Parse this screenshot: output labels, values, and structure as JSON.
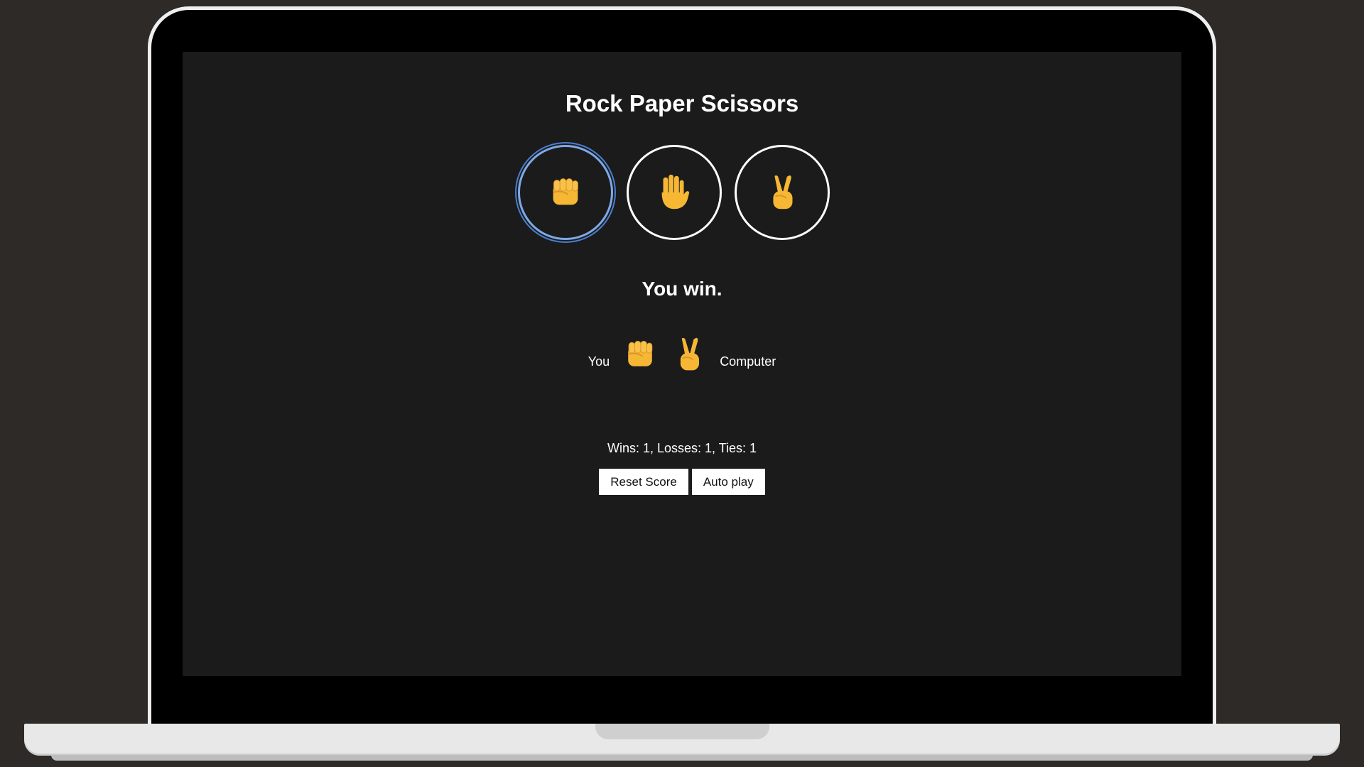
{
  "game": {
    "title": "Rock Paper Scissors",
    "moves": [
      {
        "name": "rock",
        "icon": "fist-icon",
        "focused": true
      },
      {
        "name": "paper",
        "icon": "raised-hand-icon",
        "focused": false
      },
      {
        "name": "scissors",
        "icon": "victory-hand-icon",
        "focused": false
      }
    ],
    "result": "You win.",
    "you_label": "You",
    "computer_label": "Computer",
    "player_move_icon": "fist-icon",
    "computer_move_icon": "victory-hand-icon",
    "score": "Wins: 1, Losses: 1, Ties: 1",
    "reset_label": "Reset Score",
    "autoplay_label": "Auto play"
  },
  "colors": {
    "background": "#1b1b1b",
    "emoji": "#f6b734",
    "focus_ring": "#7ea9e6"
  }
}
